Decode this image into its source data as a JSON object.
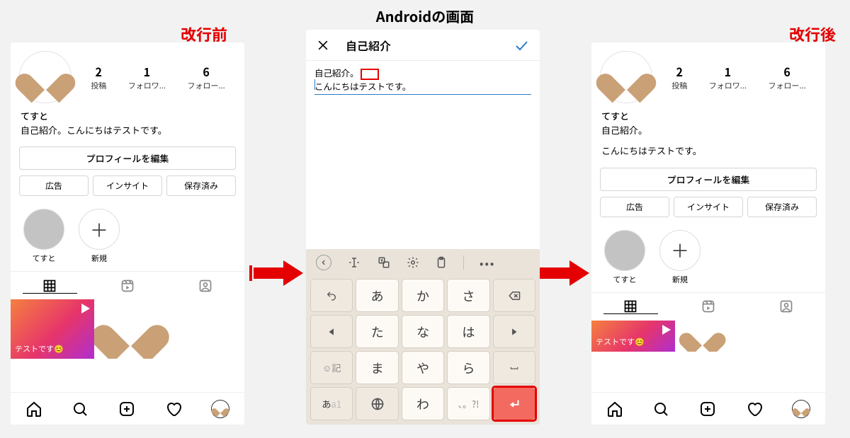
{
  "page_title": "Androidの画面",
  "captions": {
    "before": "改行前",
    "after": "改行後"
  },
  "profile": {
    "username": "てすと",
    "stats": {
      "posts": {
        "count": "2",
        "label": "投稿"
      },
      "followers": {
        "count": "1",
        "label": "フォロワ..."
      },
      "following": {
        "count": "6",
        "label": "フォロー..."
      }
    },
    "bio_before": "自己紹介。こんにちはテストです。",
    "bio_after_line1": "自己紹介。",
    "bio_after_line2": "こんにちはテストです。",
    "edit_button": "プロフィールを編集",
    "buttons": {
      "ads": "広告",
      "insights": "インサイト",
      "saved": "保存済み"
    },
    "stories": {
      "one": "てすと",
      "new": "新規"
    },
    "post_tile_text": "テストです😊"
  },
  "editor": {
    "title": "自己紹介",
    "line1": "自己紹介。",
    "line2": "こんにちはテストです。"
  },
  "keyboard": {
    "rows": [
      [
        "←",
        "あ",
        "か",
        "さ",
        "⌫"
      ],
      [
        "◀",
        "た",
        "な",
        "は",
        "▶"
      ],
      [
        "☺記",
        "ま",
        "や",
        "ら",
        "␣"
      ],
      [
        "あa1",
        "🌐",
        "わ",
        "、。?!",
        "↵"
      ]
    ]
  }
}
